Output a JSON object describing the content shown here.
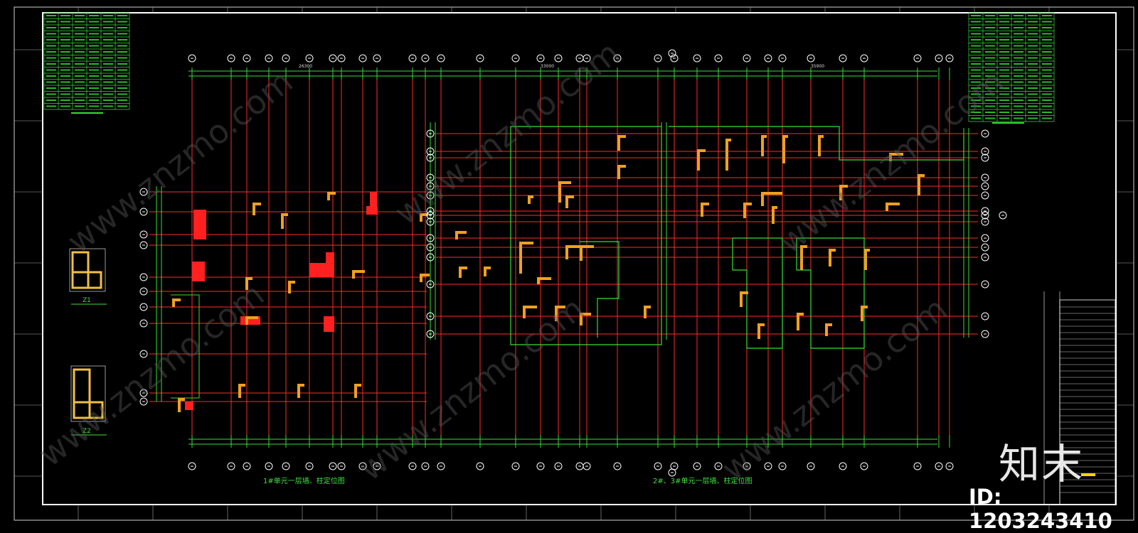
{
  "drawing": {
    "left_plan_title": "1#单元一层墙、柱定位图",
    "right_plan_title": "2#、3#单元一层墙、柱定位图",
    "left_overall_dim": "26300",
    "right_overall_dim": "35900",
    "mid_overall_dim": "33000",
    "column_detail_1": "Z1",
    "column_detail_2": "Z2"
  },
  "watermark": {
    "logo_text": "知末",
    "id_text": "ID: 1203243410",
    "site_text": "www.znzmo.com"
  },
  "colors": {
    "background": "#000000",
    "axis_line": "#ff2a2a",
    "dimension": "#35e035",
    "wall": "#f0a020",
    "border": "#ffffff"
  }
}
